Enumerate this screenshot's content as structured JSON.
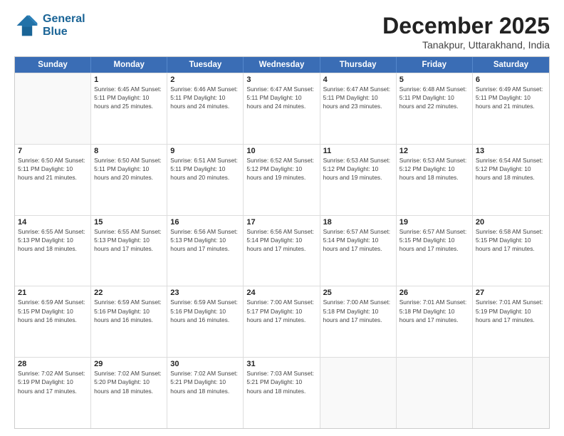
{
  "logo": {
    "line1": "General",
    "line2": "Blue"
  },
  "title": "December 2025",
  "subtitle": "Tanakpur, Uttarakhand, India",
  "header_days": [
    "Sunday",
    "Monday",
    "Tuesday",
    "Wednesday",
    "Thursday",
    "Friday",
    "Saturday"
  ],
  "weeks": [
    [
      {
        "day": "",
        "info": ""
      },
      {
        "day": "1",
        "info": "Sunrise: 6:45 AM\nSunset: 5:11 PM\nDaylight: 10 hours\nand 25 minutes."
      },
      {
        "day": "2",
        "info": "Sunrise: 6:46 AM\nSunset: 5:11 PM\nDaylight: 10 hours\nand 24 minutes."
      },
      {
        "day": "3",
        "info": "Sunrise: 6:47 AM\nSunset: 5:11 PM\nDaylight: 10 hours\nand 24 minutes."
      },
      {
        "day": "4",
        "info": "Sunrise: 6:47 AM\nSunset: 5:11 PM\nDaylight: 10 hours\nand 23 minutes."
      },
      {
        "day": "5",
        "info": "Sunrise: 6:48 AM\nSunset: 5:11 PM\nDaylight: 10 hours\nand 22 minutes."
      },
      {
        "day": "6",
        "info": "Sunrise: 6:49 AM\nSunset: 5:11 PM\nDaylight: 10 hours\nand 21 minutes."
      }
    ],
    [
      {
        "day": "7",
        "info": "Sunrise: 6:50 AM\nSunset: 5:11 PM\nDaylight: 10 hours\nand 21 minutes."
      },
      {
        "day": "8",
        "info": "Sunrise: 6:50 AM\nSunset: 5:11 PM\nDaylight: 10 hours\nand 20 minutes."
      },
      {
        "day": "9",
        "info": "Sunrise: 6:51 AM\nSunset: 5:11 PM\nDaylight: 10 hours\nand 20 minutes."
      },
      {
        "day": "10",
        "info": "Sunrise: 6:52 AM\nSunset: 5:12 PM\nDaylight: 10 hours\nand 19 minutes."
      },
      {
        "day": "11",
        "info": "Sunrise: 6:53 AM\nSunset: 5:12 PM\nDaylight: 10 hours\nand 19 minutes."
      },
      {
        "day": "12",
        "info": "Sunrise: 6:53 AM\nSunset: 5:12 PM\nDaylight: 10 hours\nand 18 minutes."
      },
      {
        "day": "13",
        "info": "Sunrise: 6:54 AM\nSunset: 5:12 PM\nDaylight: 10 hours\nand 18 minutes."
      }
    ],
    [
      {
        "day": "14",
        "info": "Sunrise: 6:55 AM\nSunset: 5:13 PM\nDaylight: 10 hours\nand 18 minutes."
      },
      {
        "day": "15",
        "info": "Sunrise: 6:55 AM\nSunset: 5:13 PM\nDaylight: 10 hours\nand 17 minutes."
      },
      {
        "day": "16",
        "info": "Sunrise: 6:56 AM\nSunset: 5:13 PM\nDaylight: 10 hours\nand 17 minutes."
      },
      {
        "day": "17",
        "info": "Sunrise: 6:56 AM\nSunset: 5:14 PM\nDaylight: 10 hours\nand 17 minutes."
      },
      {
        "day": "18",
        "info": "Sunrise: 6:57 AM\nSunset: 5:14 PM\nDaylight: 10 hours\nand 17 minutes."
      },
      {
        "day": "19",
        "info": "Sunrise: 6:57 AM\nSunset: 5:15 PM\nDaylight: 10 hours\nand 17 minutes."
      },
      {
        "day": "20",
        "info": "Sunrise: 6:58 AM\nSunset: 5:15 PM\nDaylight: 10 hours\nand 17 minutes."
      }
    ],
    [
      {
        "day": "21",
        "info": "Sunrise: 6:59 AM\nSunset: 5:15 PM\nDaylight: 10 hours\nand 16 minutes."
      },
      {
        "day": "22",
        "info": "Sunrise: 6:59 AM\nSunset: 5:16 PM\nDaylight: 10 hours\nand 16 minutes."
      },
      {
        "day": "23",
        "info": "Sunrise: 6:59 AM\nSunset: 5:16 PM\nDaylight: 10 hours\nand 16 minutes."
      },
      {
        "day": "24",
        "info": "Sunrise: 7:00 AM\nSunset: 5:17 PM\nDaylight: 10 hours\nand 17 minutes."
      },
      {
        "day": "25",
        "info": "Sunrise: 7:00 AM\nSunset: 5:18 PM\nDaylight: 10 hours\nand 17 minutes."
      },
      {
        "day": "26",
        "info": "Sunrise: 7:01 AM\nSunset: 5:18 PM\nDaylight: 10 hours\nand 17 minutes."
      },
      {
        "day": "27",
        "info": "Sunrise: 7:01 AM\nSunset: 5:19 PM\nDaylight: 10 hours\nand 17 minutes."
      }
    ],
    [
      {
        "day": "28",
        "info": "Sunrise: 7:02 AM\nSunset: 5:19 PM\nDaylight: 10 hours\nand 17 minutes."
      },
      {
        "day": "29",
        "info": "Sunrise: 7:02 AM\nSunset: 5:20 PM\nDaylight: 10 hours\nand 18 minutes."
      },
      {
        "day": "30",
        "info": "Sunrise: 7:02 AM\nSunset: 5:21 PM\nDaylight: 10 hours\nand 18 minutes."
      },
      {
        "day": "31",
        "info": "Sunrise: 7:03 AM\nSunset: 5:21 PM\nDaylight: 10 hours\nand 18 minutes."
      },
      {
        "day": "",
        "info": ""
      },
      {
        "day": "",
        "info": ""
      },
      {
        "day": "",
        "info": ""
      }
    ]
  ]
}
